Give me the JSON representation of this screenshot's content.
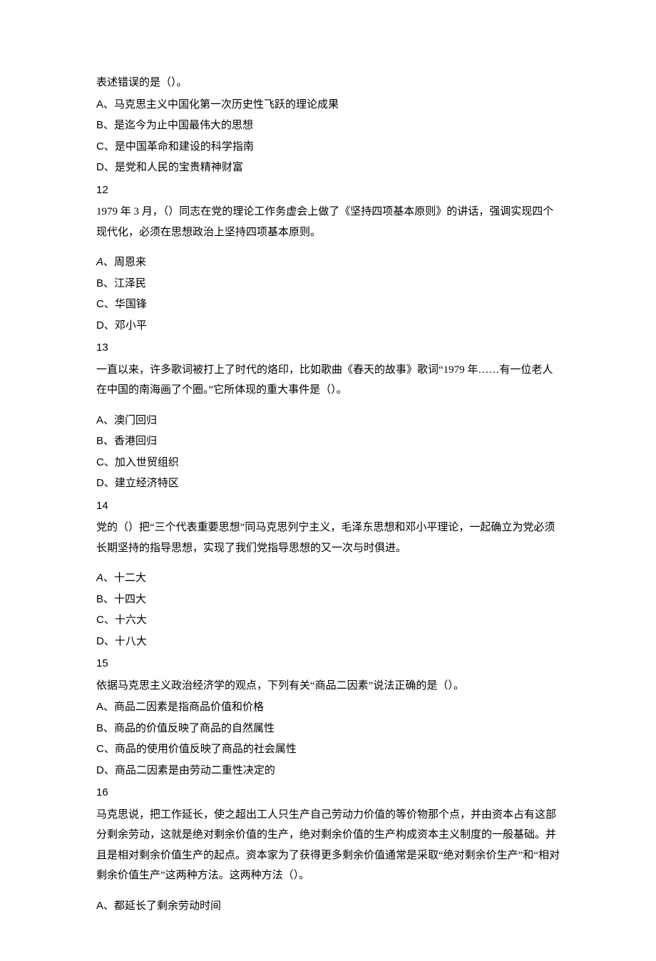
{
  "q11": {
    "fragment": "表述错误的是（）。",
    "options": {
      "A": "马克思主义中国化第一次历史性飞跃的理论成果",
      "B": "是迄今为止中国最伟大的思想",
      "C": "是中国革命和建设的科学指南",
      "D": "是党和人民的宝贵精神财富"
    }
  },
  "q12": {
    "num": "12",
    "stem": "1979 年 3 月，（）同志在党的理论工作务虚会上做了《坚持四项基本原则》的讲话，强调实现四个现代化，必须在思想政治上坚持四项基本原则。",
    "options": {
      "A": "周恩来",
      "B": "江泽民",
      "C": "华国锋",
      "D": "邓小平"
    }
  },
  "q13": {
    "num": "13",
    "stem": "一直以来，许多歌词被打上了时代的烙印，比如歌曲《春天的故事》歌词“1979 年……有一位老人在中国的南海画了个圈。”它所体现的重大事件是（）。",
    "options": {
      "A": "澳门回归",
      "B": "香港回归",
      "C": "加入世贸组织",
      "D": "建立经济特区"
    }
  },
  "q14": {
    "num": "14",
    "stem": "党的（）把“三个代表重要思想”同马克思列宁主义，毛泽东思想和邓小平理论，一起确立为党必须长期坚持的指导思想，实现了我们党指导思想的又一次与时俱进。",
    "options": {
      "A": "十二大",
      "B": "十四大",
      "C": "十六大",
      "D": "十八大"
    }
  },
  "q15": {
    "num": "15",
    "stem": "依据马克思主义政治经济学的观点，下列有关“商品二因素”说法正确的是（）。",
    "options": {
      "A": "商品二因素是指商品价值和价格",
      "B": "商品的价值反映了商品的自然属性",
      "C": "商品的使用价值反映了商品的社会属性",
      "D": "商品二因素是由劳动二重性决定的"
    }
  },
  "q16": {
    "num": "16",
    "stem": "马克思说，把工作延长，使之超出工人只生产自己劳动力价值的等价物那个点，并由资本占有这部分剩余劳动，这就是绝对剩余价值的生产，绝对剩余价值的生产构成资本主义制度的一般基础。并且是相对剩余价值生产的起点。资本家为了获得更多剩余价值通常是采取“绝对剩余价生产”和“相对剩余价值生产”这两种方法。这两种方法（）。",
    "options": {
      "A": "都延长了剩余劳动时间"
    }
  },
  "labels": {
    "A": "A、",
    "B": "B、",
    "C": "C、",
    "D": "D、"
  }
}
